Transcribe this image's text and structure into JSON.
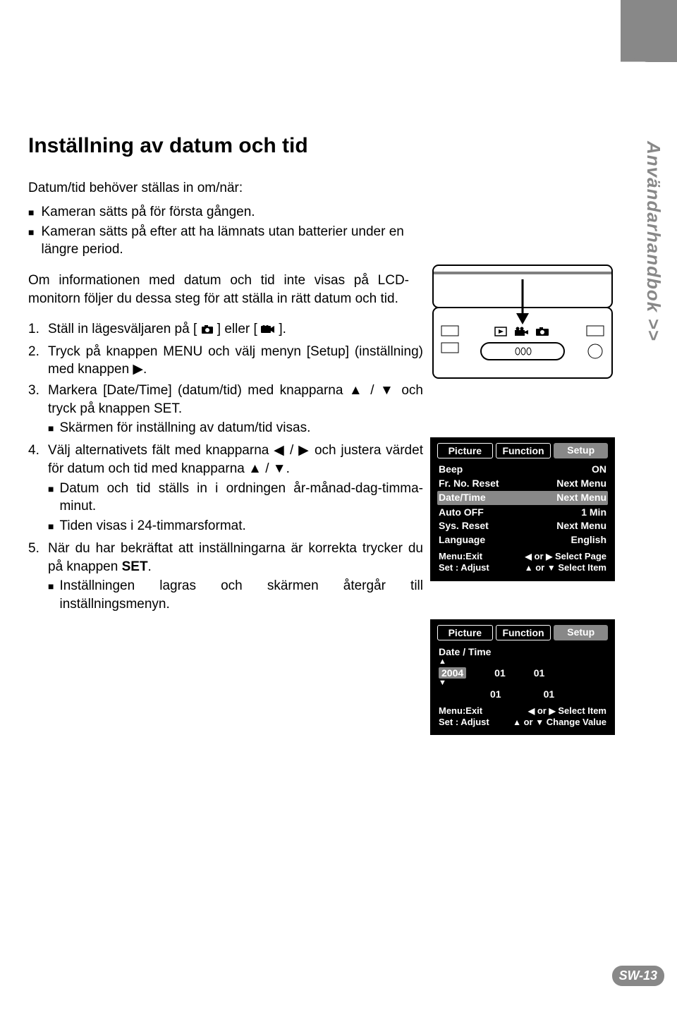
{
  "sideTab": "Användarhandbok >>",
  "pageNumber": "SW-13",
  "title": "Inställning av datum och tid",
  "intro": "Datum/tid behöver ställas in om/när:",
  "introBullets": [
    "Kameran sätts på för första gången.",
    "Kameran sätts på efter att ha lämnats utan batterier under en längre period."
  ],
  "para2": "Om informationen med datum och tid inte visas på LCD-monitorn följer du dessa steg för att ställa in rätt datum och tid.",
  "steps": {
    "s1a": "Ställ in lägesväljaren på [ ",
    "s1b": " ] eller [ ",
    "s1c": " ].",
    "s2a": "Tryck på knappen MENU och välj menyn [Setup] (inställning) med knappen ",
    "s2b": ".",
    "s3a": "Markera [Date/Time] (datum/tid) med knapparna ",
    "s3b": " / ",
    "s3c": " och tryck på knappen SET.",
    "s3_bullet": "Skärmen för inställning av datum/tid visas.",
    "s4a": "Välj alternativets fält med knapparna ",
    "s4b": " / ",
    "s4c": " och justera värdet för datum och tid med knapparna ",
    "s4d": " / ",
    "s4e": ".",
    "s4_bullets": [
      "Datum och tid ställs in i ordningen år-månad-dag-timma-minut.",
      "Tiden visas i 24-timmarsformat."
    ],
    "s5a": "När du har bekräftat att inställningarna är korrekta trycker du på knappen ",
    "s5b": "SET",
    "s5c": ".",
    "s5_bullet": "Inställningen lagras och skärmen återgår till inställningsmenyn."
  },
  "menu": {
    "tabs": {
      "picture": "Picture",
      "function": "Function",
      "setup": "Setup"
    },
    "rows": [
      {
        "l": "Beep",
        "r": "ON"
      },
      {
        "l": "Fr. No. Reset",
        "r": "Next Menu"
      },
      {
        "l": "Date/Time",
        "r": "Next Menu"
      },
      {
        "l": "Auto OFF",
        "r": "1 Min"
      },
      {
        "l": "Sys. Reset",
        "r": "Next Menu"
      },
      {
        "l": "Language",
        "r": "English"
      }
    ],
    "foot1a": "Menu:Exit",
    "foot1b": "Select Page",
    "foot2a": "Set : Adjust",
    "foot2b": "Select Item",
    "or": "or"
  },
  "menu2": {
    "heading": "Date / Time",
    "year": "2004",
    "mm": "01",
    "dd": "01",
    "hh": "01",
    "min": "01",
    "foot1a": "Menu:Exit",
    "foot1b": "Select Item",
    "foot2a": "Set : Adjust",
    "foot2b": "Change Value",
    "or": "or"
  }
}
